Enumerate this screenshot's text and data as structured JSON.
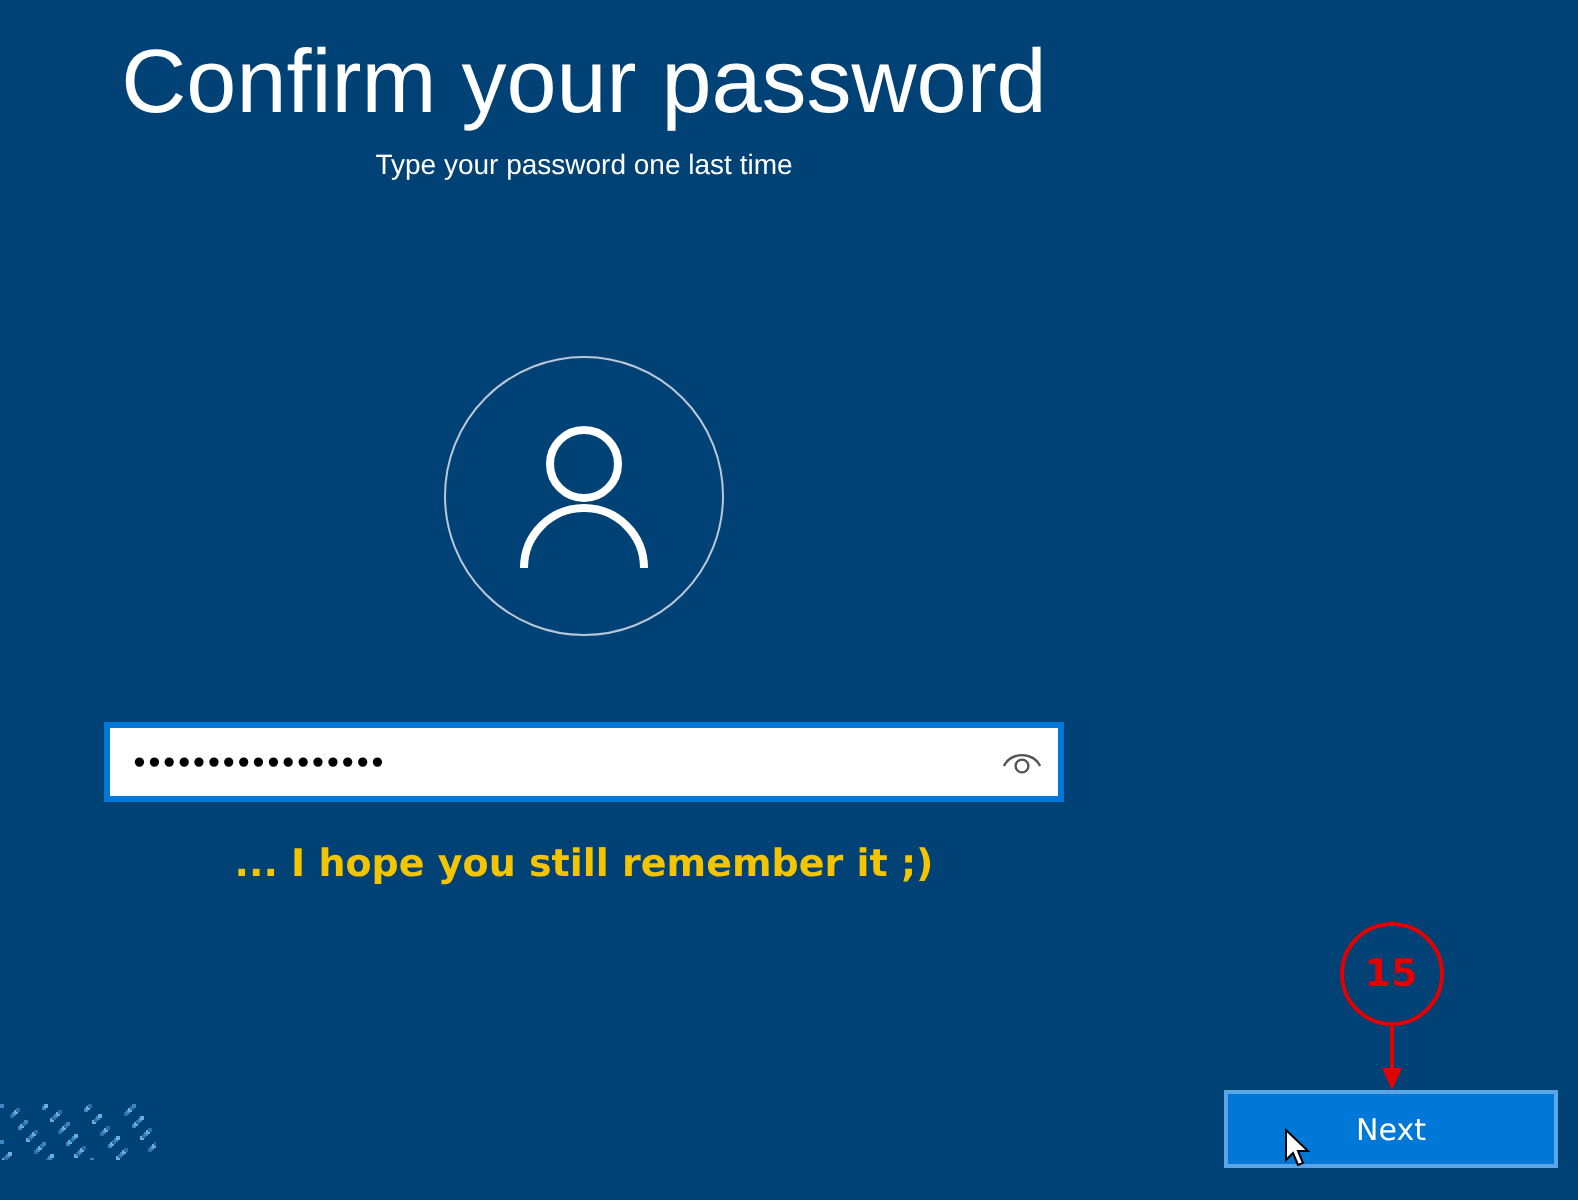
{
  "title": "Confirm your password",
  "subtitle": "Type your password one last time",
  "password_field": {
    "value": "•••••••••••••••••",
    "focused": true
  },
  "annotation": "... I hope you still remember it ;)",
  "step_marker": "15",
  "buttons": [
    {
      "label": "Next",
      "kind": "primary"
    }
  ]
}
